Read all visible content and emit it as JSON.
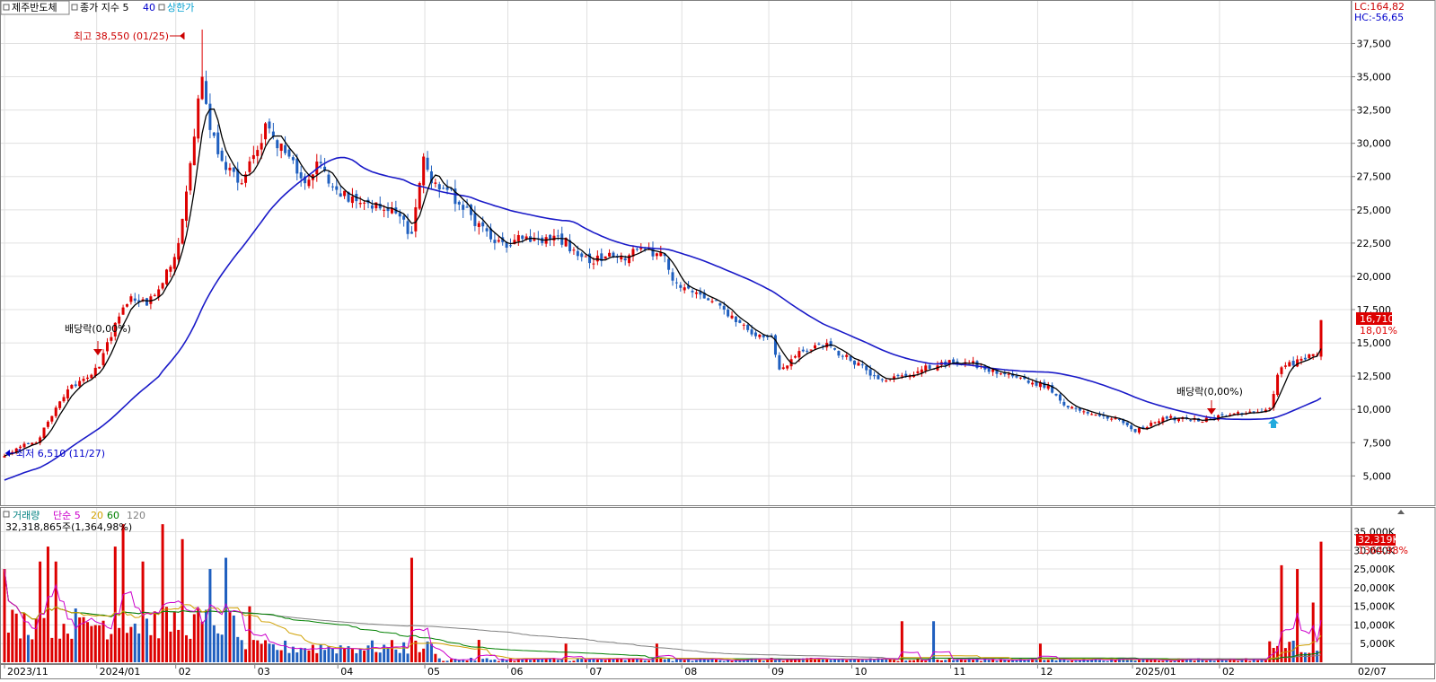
{
  "price_panel": {
    "legend": [
      {
        "text": "제주반도체",
        "color": "#000000",
        "marker": true
      },
      {
        "text": "종가 지수 5",
        "color": "#000000",
        "marker": true
      },
      {
        "text": "40",
        "color": "#0000cc",
        "marker": false
      },
      {
        "text": "상한가",
        "color": "#00a0d0",
        "marker": true
      }
    ],
    "lc_label": "LC:164,82",
    "hc_label": "HC:-56,65",
    "high_annotation": "최고 38,550 (01/25)",
    "low_annotation": "최저 6,510 (11/27)",
    "dividend_labels": [
      "배당락(0,00%)",
      "배당락(0,00%)"
    ],
    "last_price_tag": "16,710",
    "last_change_tag": "18,01%",
    "y_ticks": [
      "5,000",
      "7,500",
      "10,000",
      "12,500",
      "15,000",
      "17,500",
      "20,000",
      "22,500",
      "25,000",
      "27,500",
      "30,000",
      "32,500",
      "35,000",
      "37,500"
    ]
  },
  "volume_panel": {
    "legend": [
      {
        "text": "거래량",
        "color": "#008080"
      },
      {
        "text": "단순 5",
        "color": "#cc00cc"
      },
      {
        "text": "20",
        "color": "#d0a000"
      },
      {
        "text": "60",
        "color": "#008000"
      },
      {
        "text": "120",
        "color": "#808080"
      }
    ],
    "subtitle": "32,318,865주(1,364,98%)",
    "last_volume_tag": "32,319K",
    "last_volume_pct_tag": "1364,98%",
    "y_ticks": [
      "5,000K",
      "10,000K",
      "15,000K",
      "20,000K",
      "25,000K",
      "30,000K",
      "35,000K"
    ]
  },
  "x_axis": {
    "labels": [
      "2023/11",
      "2024/01",
      "02",
      "03",
      "04",
      "05",
      "06",
      "07",
      "08",
      "09",
      "10",
      "11",
      "12",
      "2025/01",
      "02"
    ],
    "end_label": "02/07"
  },
  "chart_data": {
    "type": "candlestick",
    "title": "제주반도체",
    "y_range": [
      3000,
      40500
    ],
    "volume_range_k": [
      0,
      38000
    ],
    "anchors_close": [
      [
        0,
        6510
      ],
      [
        4,
        7200
      ],
      [
        8,
        7500
      ],
      [
        12,
        9500
      ],
      [
        16,
        11500
      ],
      [
        20,
        12300
      ],
      [
        24,
        13200
      ],
      [
        28,
        16500
      ],
      [
        32,
        18500
      ],
      [
        36,
        17800
      ],
      [
        40,
        19500
      ],
      [
        44,
        22500
      ],
      [
        48,
        30500
      ],
      [
        50,
        35000
      ],
      [
        52,
        31000
      ],
      [
        56,
        28000
      ],
      [
        60,
        27000
      ],
      [
        64,
        29500
      ],
      [
        66,
        31500
      ],
      [
        68,
        30500
      ],
      [
        72,
        29000
      ],
      [
        76,
        27000
      ],
      [
        80,
        28500
      ],
      [
        84,
        26500
      ],
      [
        88,
        26000
      ],
      [
        92,
        25500
      ],
      [
        96,
        25000
      ],
      [
        100,
        24500
      ],
      [
        103,
        23200
      ],
      [
        106,
        29000
      ],
      [
        108,
        27000
      ],
      [
        112,
        26500
      ],
      [
        116,
        25000
      ],
      [
        120,
        24000
      ],
      [
        124,
        22500
      ],
      [
        128,
        22300
      ],
      [
        132,
        23000
      ],
      [
        136,
        22500
      ],
      [
        140,
        23000
      ],
      [
        144,
        22000
      ],
      [
        148,
        21000
      ],
      [
        152,
        21500
      ],
      [
        156,
        21500
      ],
      [
        160,
        22000
      ],
      [
        164,
        21500
      ],
      [
        166,
        21800
      ],
      [
        170,
        19500
      ],
      [
        174,
        18800
      ],
      [
        178,
        18200
      ],
      [
        182,
        17500
      ],
      [
        186,
        16500
      ],
      [
        190,
        15500
      ],
      [
        194,
        15500
      ],
      [
        196,
        13000
      ],
      [
        200,
        14000
      ],
      [
        204,
        14500
      ],
      [
        208,
        15000
      ],
      [
        212,
        14000
      ],
      [
        216,
        13500
      ],
      [
        220,
        12500
      ],
      [
        224,
        12300
      ],
      [
        228,
        12500
      ],
      [
        232,
        13000
      ],
      [
        236,
        13300
      ],
      [
        240,
        13500
      ],
      [
        244,
        13500
      ],
      [
        248,
        13000
      ],
      [
        252,
        12700
      ],
      [
        256,
        12400
      ],
      [
        260,
        12000
      ],
      [
        264,
        11800
      ],
      [
        268,
        10300
      ],
      [
        272,
        9900
      ],
      [
        276,
        9600
      ],
      [
        280,
        9300
      ],
      [
        284,
        8800
      ],
      [
        286,
        8300
      ],
      [
        290,
        9000
      ],
      [
        294,
        9300
      ],
      [
        298,
        9400
      ],
      [
        302,
        9100
      ],
      [
        306,
        9300
      ],
      [
        310,
        9600
      ],
      [
        314,
        9700
      ],
      [
        318,
        9800
      ],
      [
        320,
        10100
      ],
      [
        322,
        12600
      ],
      [
        324,
        13300
      ],
      [
        328,
        13800
      ],
      [
        332,
        14100
      ],
      [
        333,
        16710
      ]
    ],
    "events": {
      "high": {
        "date": "01/25",
        "value": 38550
      },
      "low": {
        "date": "11/27",
        "value": 6510
      },
      "last": {
        "date": "02/07",
        "close": 16710,
        "change_pct": 18.01,
        "volume": 32318865
      }
    },
    "volume_spikes_k": [
      [
        0,
        25000
      ],
      [
        9,
        27000
      ],
      [
        11,
        31000
      ],
      [
        13,
        27000
      ],
      [
        19,
        12000
      ],
      [
        28,
        31000
      ],
      [
        30,
        37000
      ],
      [
        35,
        27000
      ],
      [
        40,
        37000
      ],
      [
        45,
        33000
      ],
      [
        52,
        25000
      ],
      [
        56,
        28000
      ],
      [
        62,
        15000
      ],
      [
        103,
        28000
      ],
      [
        120,
        6000
      ],
      [
        142,
        5000
      ],
      [
        165,
        5000
      ],
      [
        227,
        11000
      ],
      [
        235,
        11000
      ],
      [
        262,
        5000
      ],
      [
        323,
        26000
      ],
      [
        327,
        25000
      ],
      [
        331,
        16000
      ],
      [
        333,
        32319
      ]
    ],
    "total_bars": 334
  }
}
